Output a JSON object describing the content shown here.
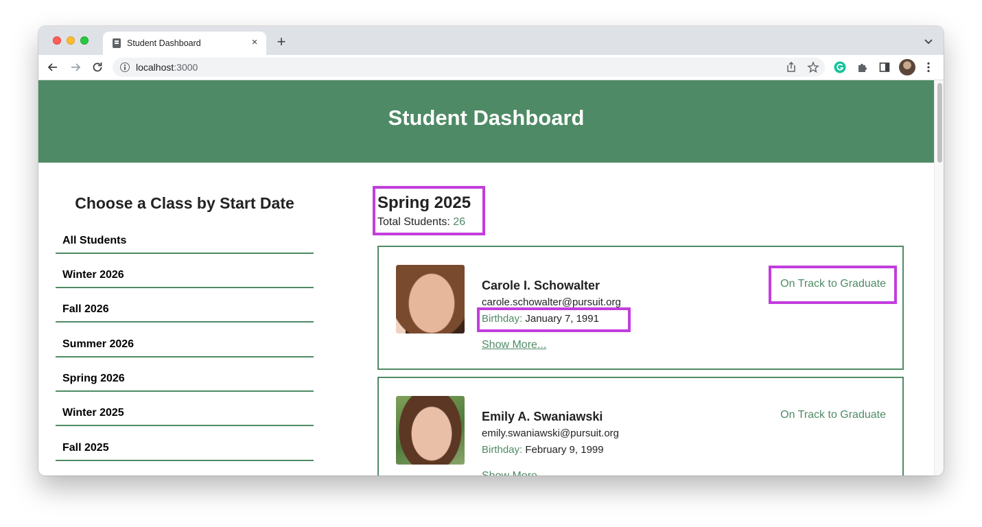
{
  "browser": {
    "tab_title": "Student Dashboard",
    "tab_close": "×",
    "new_tab": "+",
    "url_host": "localhost",
    "url_port": ":3000"
  },
  "header": {
    "title": "Student Dashboard"
  },
  "sidebar": {
    "heading": "Choose a Class by Start Date",
    "items": [
      {
        "label": "All Students"
      },
      {
        "label": "Winter 2026"
      },
      {
        "label": "Fall 2026"
      },
      {
        "label": "Summer 2026"
      },
      {
        "label": "Spring 2026"
      },
      {
        "label": "Winter 2025"
      },
      {
        "label": "Fall 2025"
      }
    ]
  },
  "cohort": {
    "title": "Spring 2025",
    "total_label": "Total Students: ",
    "total_value": "26"
  },
  "students": [
    {
      "name": "Carole I. Schowalter",
      "email": "carole.schowalter@pursuit.org",
      "birthday_label": "Birthday:",
      "birthday": " January 7, 1991",
      "show_more": "Show More...",
      "status": "On Track to Graduate"
    },
    {
      "name": "Emily A. Swaniawski",
      "email": "emily.swaniawski@pursuit.org",
      "birthday_label": "Birthday:",
      "birthday": " February 9, 1999",
      "show_more": "Show More...",
      "status": "On Track to Graduate"
    }
  ],
  "colors": {
    "accent_green": "#4e8a65",
    "highlight_purple": "#c23ddd"
  }
}
